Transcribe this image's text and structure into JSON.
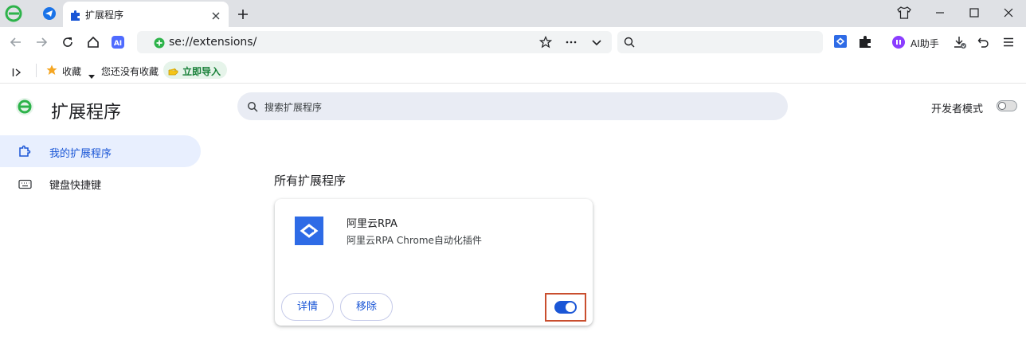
{
  "browser": {
    "tab": {
      "title": "扩展程序"
    },
    "address": {
      "url": "se://extensions/"
    },
    "toolbar": {
      "ai_label": "AI助手"
    }
  },
  "bookmarks": {
    "favorites_label": "收藏",
    "empty_text": "您还没有收藏",
    "import_label": "立即导入"
  },
  "page": {
    "title": "扩展程序",
    "search_placeholder": "搜索扩展程序",
    "developer_mode_label": "开发者模式",
    "developer_mode_on": false
  },
  "sidebar": {
    "items": [
      {
        "label": "我的扩展程序",
        "active": true
      },
      {
        "label": "键盘快捷键",
        "active": false
      }
    ]
  },
  "main": {
    "section_title": "所有扩展程序",
    "extension": {
      "name": "阿里云RPA",
      "description": "阿里云RPA Chrome自动化插件",
      "details_label": "详情",
      "remove_label": "移除",
      "enabled": true
    }
  },
  "colors": {
    "accent": "#1a56d6",
    "highlight_border": "#c94e2e",
    "nav_active_bg": "#e8effe",
    "search_bg": "#e9ecf4"
  }
}
